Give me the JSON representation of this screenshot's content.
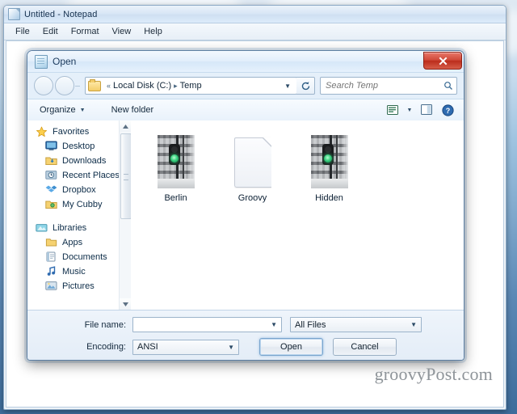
{
  "notepad": {
    "title": "Untitled - Notepad",
    "icon": "notepad-document-icon",
    "menu": [
      "File",
      "Edit",
      "Format",
      "View",
      "Help"
    ]
  },
  "dialog": {
    "title": "Open",
    "icon": "open-dialog-icon",
    "close_label": "✕",
    "nav": {
      "back_icon": "back-arrow-icon",
      "forward_icon": "forward-arrow-icon",
      "breadcrumb_overflow": "«",
      "breadcrumbs": [
        "Local Disk (C:)",
        "Temp"
      ],
      "breadcrumb_separator": "▸",
      "address_dropdown_icon": "chevron-down-icon",
      "refresh_icon": "refresh-icon",
      "search_placeholder": "Search Temp",
      "search_value": "",
      "search_icon": "search-icon"
    },
    "toolbar": {
      "organize_label": "Organize",
      "organize_caret": "▼",
      "new_folder_label": "New folder",
      "views_icon": "views-icon",
      "views_caret": "▼",
      "preview_pane_icon": "preview-pane-icon",
      "help_icon": "help-icon",
      "help_glyph": "?"
    },
    "sidebar": {
      "groups": [
        {
          "title": "Favorites",
          "icon": "star-icon",
          "items": [
            {
              "label": "Desktop",
              "icon": "desktop-icon"
            },
            {
              "label": "Downloads",
              "icon": "downloads-folder-icon"
            },
            {
              "label": "Recent Places",
              "icon": "recent-places-icon"
            },
            {
              "label": "Dropbox",
              "icon": "dropbox-icon"
            },
            {
              "label": "My Cubby",
              "icon": "my-cubby-folder-icon"
            }
          ]
        },
        {
          "title": "Libraries",
          "icon": "libraries-icon",
          "items": [
            {
              "label": "Apps",
              "icon": "folder-icon"
            },
            {
              "label": "Documents",
              "icon": "documents-library-icon"
            },
            {
              "label": "Music",
              "icon": "music-note-icon"
            },
            {
              "label": "Pictures",
              "icon": "pictures-library-icon"
            }
          ]
        }
      ],
      "scrollbar": {
        "up_arrow": "▲",
        "down_arrow": "▼"
      }
    },
    "files": [
      {
        "name": "Berlin",
        "thumb": "photo-traffic-light"
      },
      {
        "name": "Groovy",
        "thumb": "blank-document"
      },
      {
        "name": "Hidden",
        "thumb": "photo-traffic-light"
      }
    ],
    "bottom": {
      "file_name_label": "File name:",
      "file_name_value": "",
      "file_type_value": "All Files",
      "encoding_label": "Encoding:",
      "encoding_value": "ANSI",
      "open_button": "Open",
      "cancel_button": "Cancel",
      "caret": "▼"
    }
  },
  "watermark": "groovyPost.com",
  "colors": {
    "close_red": "#c0392b",
    "accent_blue": "#7aa5cd",
    "signal_green": "#38d07e",
    "folder_yellow": "#f3cd6a"
  }
}
